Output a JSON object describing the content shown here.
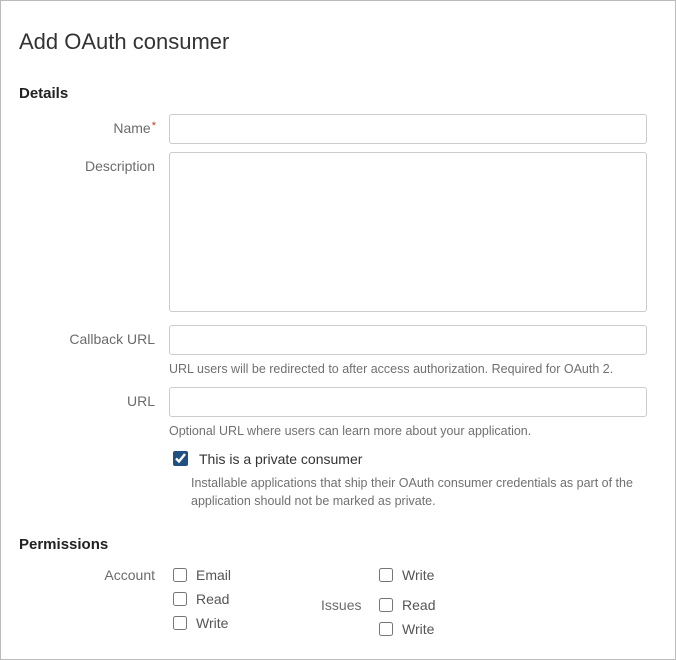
{
  "page_title": "Add OAuth consumer",
  "sections": {
    "details": {
      "title": "Details",
      "name": {
        "label": "Name",
        "required": true,
        "value": ""
      },
      "description": {
        "label": "Description",
        "value": ""
      },
      "callback_url": {
        "label": "Callback URL",
        "value": "",
        "help": "URL users will be redirected to after access authorization. Required for OAuth 2."
      },
      "url": {
        "label": "URL",
        "value": "",
        "help": "Optional URL where users can learn more about your application."
      },
      "private_consumer": {
        "label": "This is a private consumer",
        "checked": true,
        "help": "Installable applications that ship their OAuth consumer credentials as part of the application should not be marked as private."
      }
    },
    "permissions": {
      "title": "Permissions",
      "groups": {
        "account": {
          "label": "Account",
          "options": [
            {
              "label": "Email",
              "checked": false
            },
            {
              "label": "Read",
              "checked": false
            },
            {
              "label": "Write",
              "checked": false
            }
          ]
        },
        "right_top": {
          "options": [
            {
              "label": "Write",
              "checked": false
            }
          ]
        },
        "issues": {
          "label": "Issues",
          "options": [
            {
              "label": "Read",
              "checked": false
            },
            {
              "label": "Write",
              "checked": false
            }
          ]
        }
      }
    }
  }
}
